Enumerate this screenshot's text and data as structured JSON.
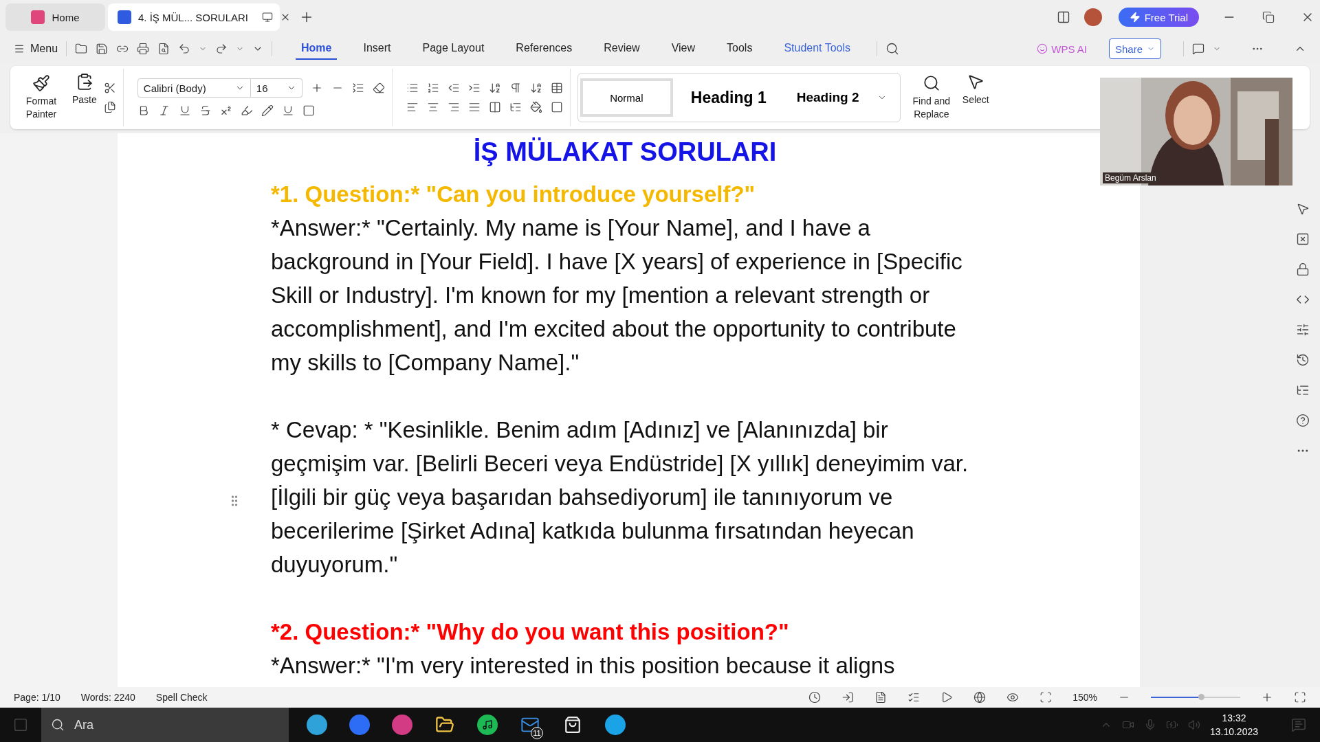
{
  "tabs": [
    {
      "kind": "home",
      "label": "Home",
      "selected": false
    },
    {
      "kind": "doc",
      "label": "4. İŞ MÜL... SORULARI",
      "selected": true
    }
  ],
  "free_trial": "Free Trial",
  "menu": {
    "label": "Menu",
    "tabs": [
      {
        "label": "Home",
        "selected": true,
        "accent": false
      },
      {
        "label": "Insert",
        "selected": false,
        "accent": false
      },
      {
        "label": "Page Layout",
        "selected": false,
        "accent": false
      },
      {
        "label": "References",
        "selected": false,
        "accent": false
      },
      {
        "label": "Review",
        "selected": false,
        "accent": false
      },
      {
        "label": "View",
        "selected": false,
        "accent": false
      },
      {
        "label": "Tools",
        "selected": false,
        "accent": false
      },
      {
        "label": "Student Tools",
        "selected": false,
        "accent": true
      }
    ],
    "wps_ai": "WPS AI",
    "share": "Share"
  },
  "ribbon": {
    "format_painter": "Format Painter",
    "paste": "Paste",
    "font": "Calibri (Body)",
    "size": "16",
    "styles": [
      {
        "label": "Normal",
        "kind": "normal",
        "selected": true
      },
      {
        "label": "Heading 1",
        "kind": "h1",
        "selected": false
      },
      {
        "label": "Heading 2",
        "kind": "h2",
        "selected": false
      }
    ],
    "find": "Find and Replace",
    "select": "Select"
  },
  "webcam": {
    "name": "Begüm Arslan"
  },
  "document": {
    "title": "İŞ MÜLAKAT SORULARI",
    "blocks": [
      {
        "kind": "question",
        "color": "#f5b800",
        "text": "*1. Question:* \"Can you introduce yourself?\""
      },
      {
        "kind": "answer",
        "text": "*Answer:* \"Certainly. My name is [Your Name], and I have a background in [Your Field]. I have [X years] of experience in [Specific Skill or Industry]. I'm known for my [mention a relevant strength or accomplishment], and I'm excited about the opportunity to contribute my skills to [Company Name].\""
      },
      {
        "kind": "answer",
        "text": "* Cevap: * \"Kesinlikle. Benim adım [Adınız] ve [Alanınızda] bir geçmişim var. [Belirli Beceri veya Endüstride] [X yıllık] deneyimim var. [İlgili bir güç veya başarıdan bahsediyorum] ile tanınıyorum ve becerilerime [Şirket Adına] katkıda bulunma fırsatından heyecan duyuyorum.\""
      },
      {
        "kind": "question",
        "color": "#ff0000",
        "text": "*2. Question:* \"Why do you want this position?\""
      },
      {
        "kind": "answer",
        "text": "*Answer:* \"I'm very interested in this position because it aligns"
      }
    ]
  },
  "status": {
    "page": "Page: 1/10",
    "words": "Words: 2240",
    "spell": "Spell Check",
    "zoom": "150%",
    "zoom_slider": {
      "level": 0.56
    }
  },
  "taskbar": {
    "search": "Ara",
    "mail_badge": "11",
    "time": "13:32",
    "date": "13.10.2023"
  }
}
